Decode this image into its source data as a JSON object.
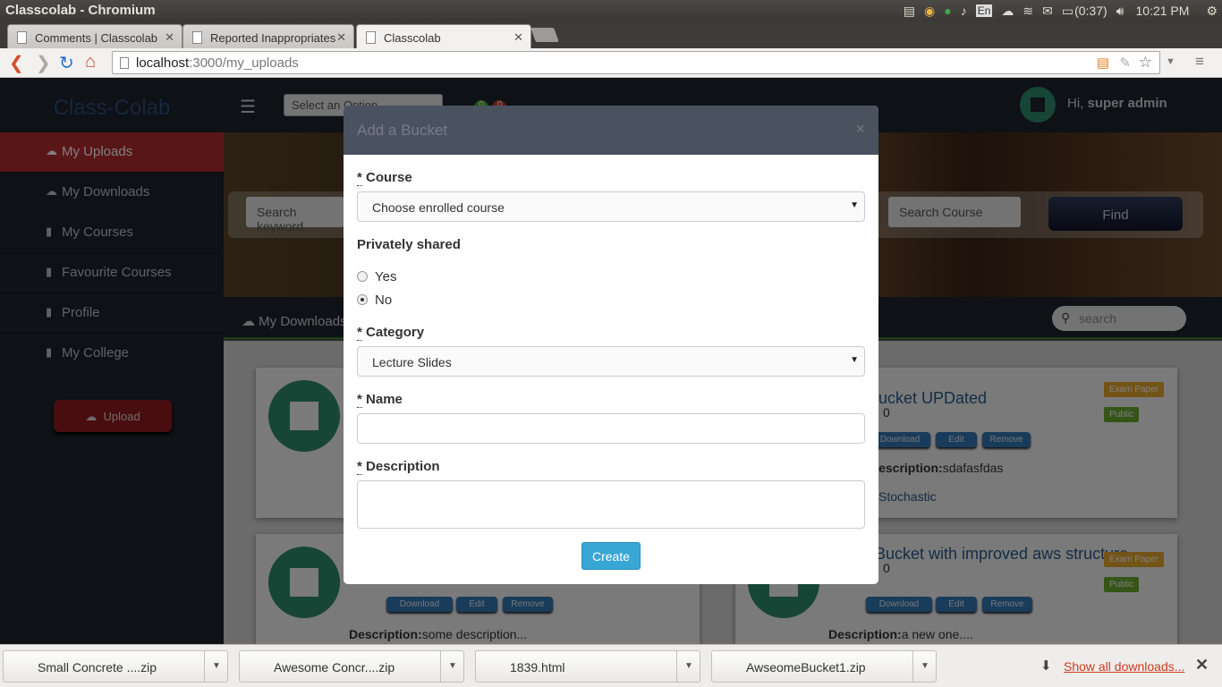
{
  "os": {
    "window_title": "Classcolab - Chromium",
    "lang": "En",
    "battery": "(0:37)",
    "time": "10:21 PM"
  },
  "tabs": [
    {
      "label": "Comments | Classcolab"
    },
    {
      "label": "Reported Inappropriates"
    },
    {
      "label": "Classcolab"
    }
  ],
  "nav": {
    "url_host": "localhost",
    "url_path": ":3000/my_uploads"
  },
  "sidebar": {
    "brand": "Class-Colab",
    "items": [
      {
        "label": "My Uploads"
      },
      {
        "label": "My Downloads"
      },
      {
        "label": "My Courses"
      },
      {
        "label": "Favourite Courses"
      },
      {
        "label": "Profile"
      },
      {
        "label": "My College"
      }
    ],
    "upload_label": "Upload"
  },
  "topnav": {
    "select_placeholder": "Select an Option",
    "badge_green": "0",
    "badge_red": "0",
    "greeting_prefix": "Hi, ",
    "user_name": "super admin"
  },
  "hero": {
    "keyword_placeholder": "Search keyword",
    "course_placeholder": "Search Course",
    "find_label": "Find"
  },
  "subnav": {
    "title": "My Downloads",
    "search_placeholder": "search"
  },
  "cards": [
    {
      "title": "bucket UPDated",
      "rating": "0",
      "tag1": "Exam Paper",
      "tag2": "Public",
      "desc_label": "Description:",
      "desc": "sdafasfdas",
      "course": "Stochastic"
    },
    {
      "title": "Bucket with improved aws structure",
      "rating": "0",
      "tag1": "Exam Paper",
      "tag2": "Public",
      "desc_label": "Description:",
      "desc": "a new one...."
    },
    {
      "desc_label": "Description:",
      "desc": "some description..."
    }
  ],
  "card_buttons": {
    "download": "Download",
    "edit": "Edit",
    "remove": "Remove"
  },
  "modal": {
    "title": "Add a Bucket",
    "close": "×",
    "course_label": "Course",
    "course_value": "Choose enrolled course",
    "privacy_label": "Privately shared",
    "privacy_yes": "Yes",
    "privacy_no": "No",
    "privacy_selected": "No",
    "category_label": "Category",
    "category_value": "Lecture Slides",
    "name_label": "Name",
    "name_value": "",
    "description_label": "Description",
    "description_value": "",
    "create_label": "Create"
  },
  "downloads": [
    {
      "name": "Small Concrete ....zip"
    },
    {
      "name": "Awesome Concr....zip"
    },
    {
      "name": "1839.html"
    },
    {
      "name": "AwseomeBucket1.zip"
    }
  ],
  "downloads_bar": {
    "show_all": "Show all downloads..."
  }
}
